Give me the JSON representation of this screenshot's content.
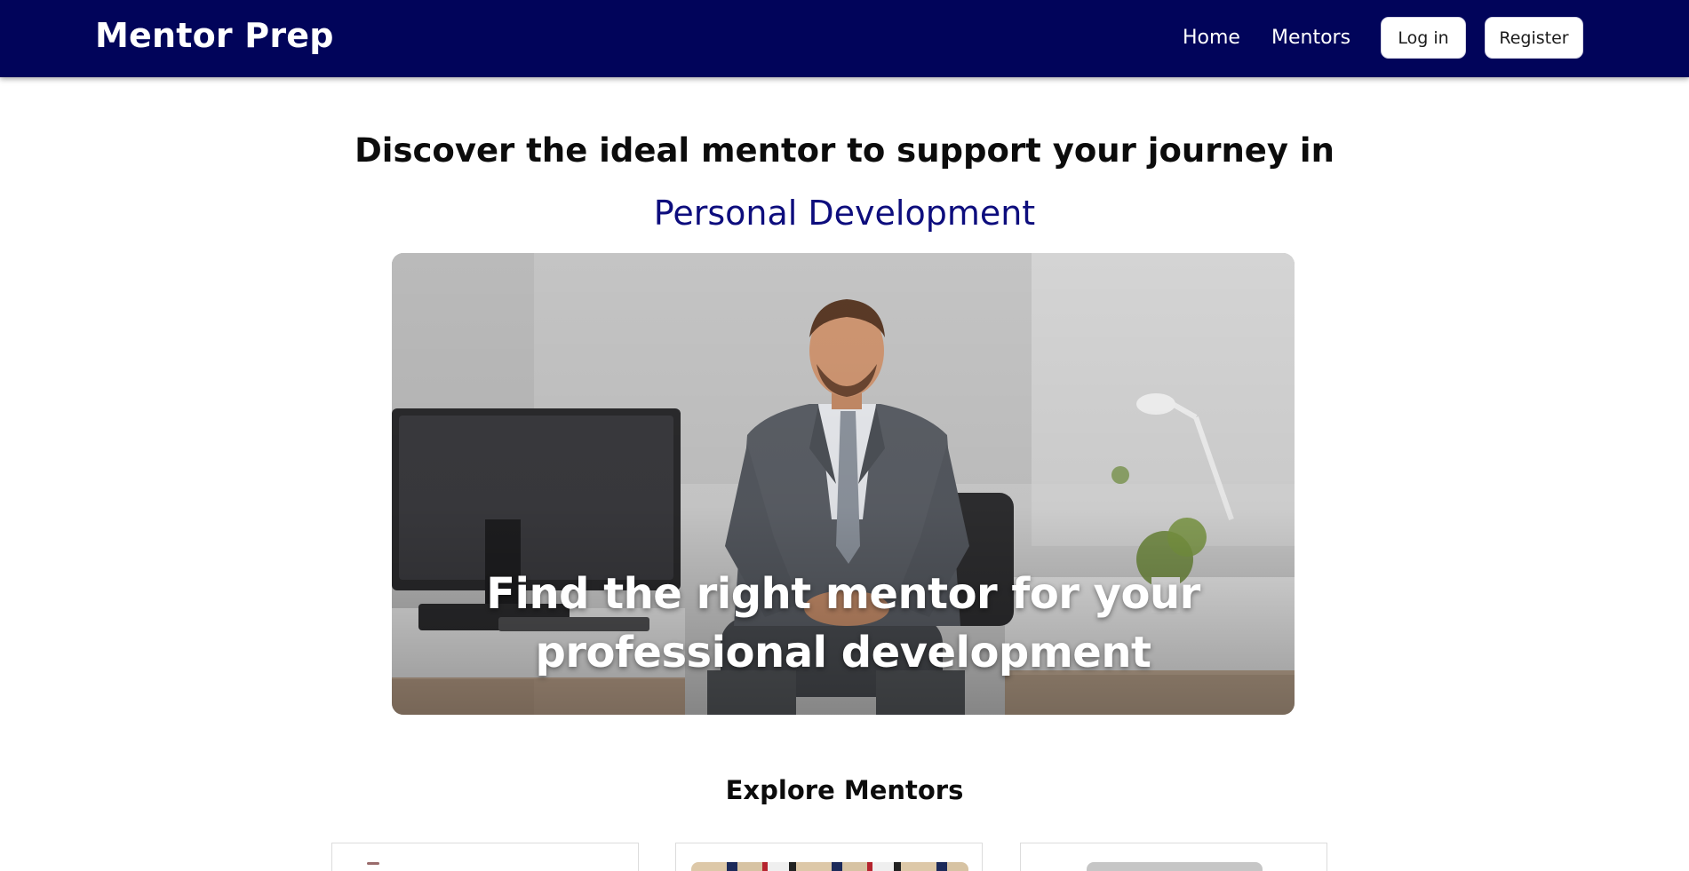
{
  "navbar": {
    "brand": "Mentor Prep",
    "links": [
      "Home",
      "Mentors"
    ],
    "login_label": "Log in",
    "register_label": "Register"
  },
  "hero": {
    "title": "Discover the ideal mentor to support your journey in",
    "subtitle": "Personal Development",
    "banner_caption_line1": "Find the right mentor for your",
    "banner_caption_line2": "professional development"
  },
  "explore": {
    "title": "Explore Mentors"
  },
  "colors": {
    "navbar": "#01045a",
    "accent_text": "#0d0d7d"
  }
}
